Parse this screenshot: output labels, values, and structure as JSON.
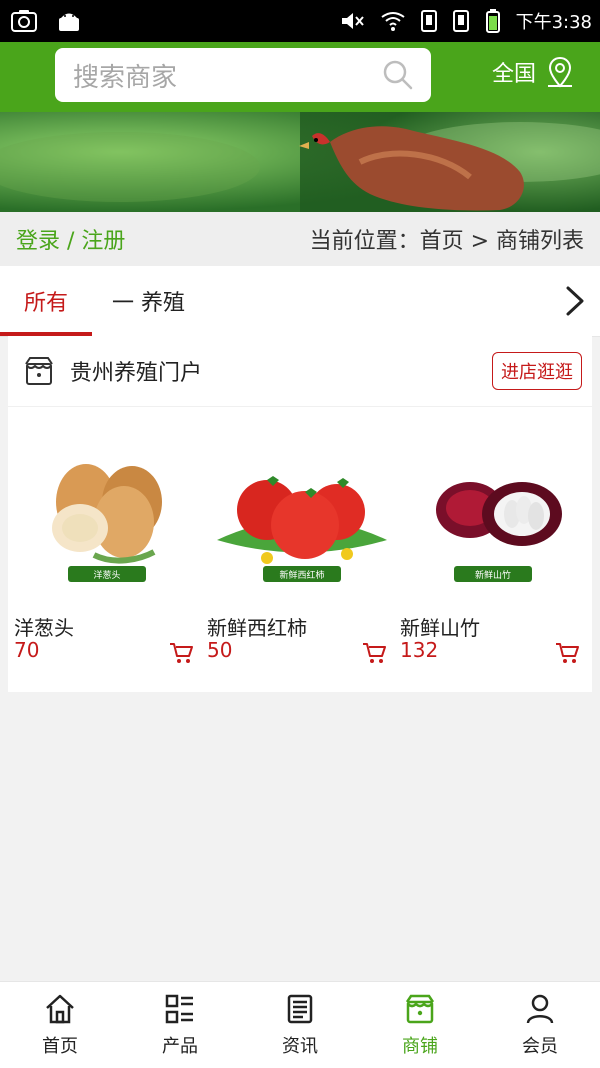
{
  "status": {
    "time": "下午3:38"
  },
  "header": {
    "search_placeholder": "搜索商家",
    "region_label": "全国"
  },
  "breadcrumbs": {
    "login_label": "登录 / 注册",
    "location_text": "当前位置：首页 > 商铺列表"
  },
  "tabs": {
    "all_label": "所有",
    "category_label": "一 养殖"
  },
  "shop": {
    "name": "贵州养殖门户",
    "visit_label": "进店逛逛"
  },
  "products": [
    {
      "name": "洋葱头",
      "price": "70",
      "tag": "洋葱头"
    },
    {
      "name": "新鲜西红柿",
      "price": "50",
      "tag": "新鲜西红柿"
    },
    {
      "name": "新鲜山竹",
      "price": "132",
      "tag": "新鲜山竹"
    }
  ],
  "bottom_nav": [
    {
      "label": "首页",
      "icon": "home-icon"
    },
    {
      "label": "产品",
      "icon": "grid-list-icon"
    },
    {
      "label": "资讯",
      "icon": "news-icon"
    },
    {
      "label": "商铺",
      "icon": "shop-icon"
    },
    {
      "label": "会员",
      "icon": "user-icon"
    }
  ],
  "colors": {
    "brand_green": "#4aa51b",
    "accent_red": "#c51a1a"
  }
}
